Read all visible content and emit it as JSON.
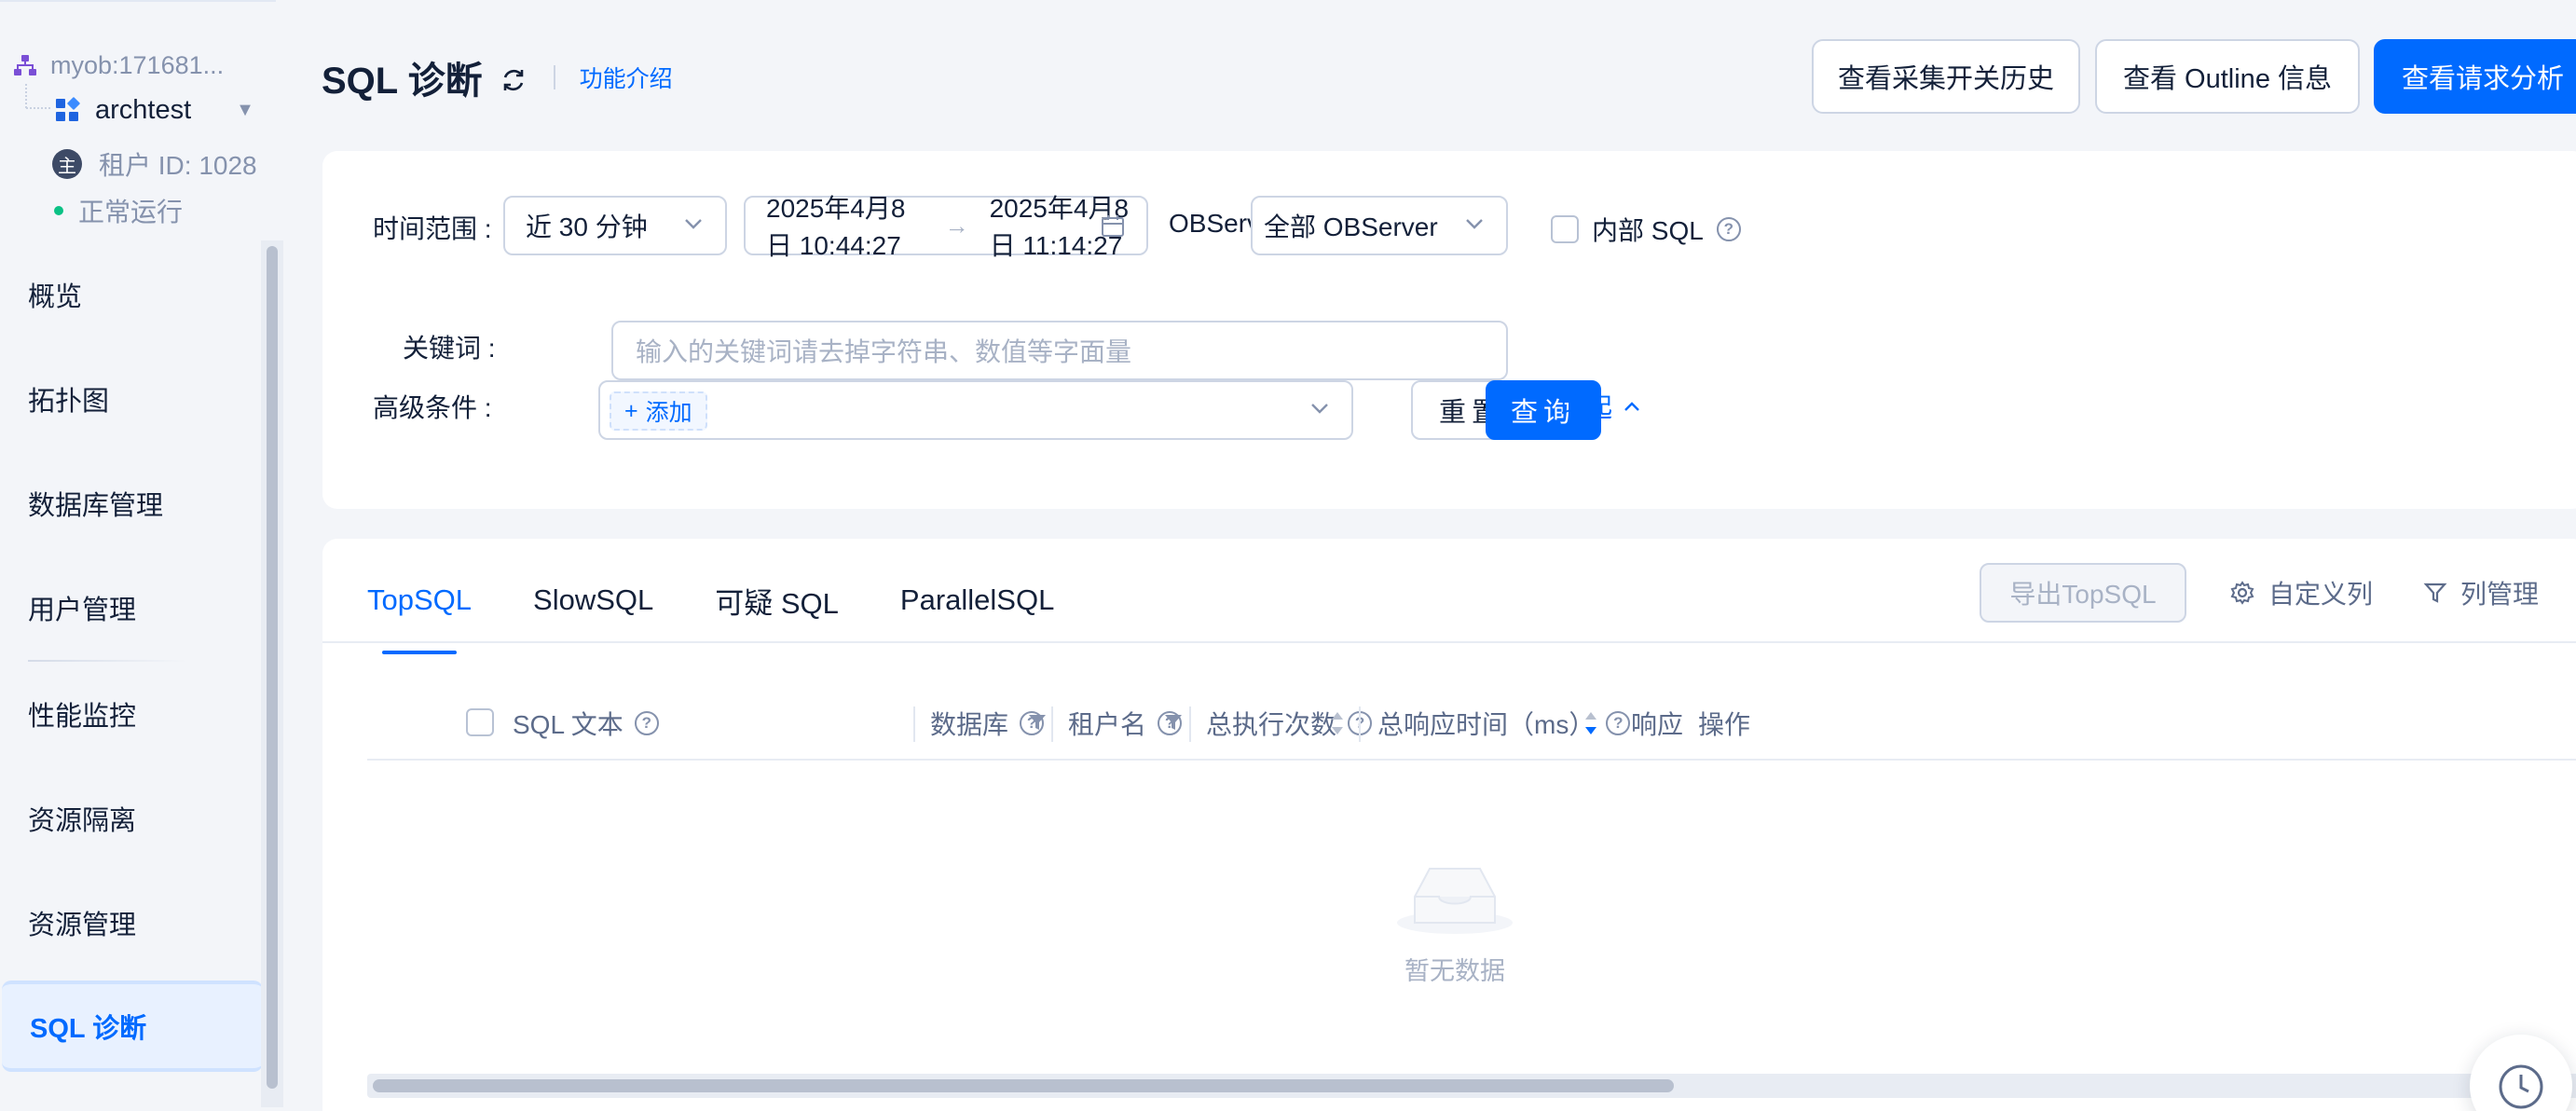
{
  "sidebar": {
    "cluster": "myob:171681...",
    "tenant": "archtest",
    "tenant_id_badge": "主",
    "tenant_id": "租户 ID: 1028",
    "status": "正常运行",
    "items": [
      {
        "label": "概览"
      },
      {
        "label": "拓扑图"
      },
      {
        "label": "数据库管理"
      },
      {
        "label": "用户管理"
      },
      {
        "label": "性能监控"
      },
      {
        "label": "资源隔离"
      },
      {
        "label": "资源管理"
      },
      {
        "label": "SQL 诊断"
      }
    ]
  },
  "header": {
    "title": "SQL 诊断",
    "intro_link": "功能介绍",
    "btn_collect_history": "查看采集开关历史",
    "btn_outline": "查看 Outline 信息",
    "btn_request_analysis": "查看请求分析"
  },
  "filters": {
    "time_range_label": "时间范围 :",
    "time_range_value": "近 30 分钟",
    "date_start": "2025年4月8日 10:44:27",
    "date_end": "2025年4月8日 11:14:27",
    "observer_label": "OBServer :",
    "observer_value": "全部 OBServer",
    "internal_sql_label": "内部 SQL",
    "keyword_label": "关键词 :",
    "keyword_placeholder": "输入的关键词请去掉字符串、数值等字面量",
    "advanced_label": "高级条件 :",
    "add_label": "添加",
    "reset_label": "重置",
    "query_label": "查询",
    "collapse_label": "收起"
  },
  "tabs": [
    {
      "label": "TopSQL"
    },
    {
      "label": "SlowSQL"
    },
    {
      "label": "可疑 SQL"
    },
    {
      "label": "ParallelSQL"
    }
  ],
  "toolbar": {
    "export_label": "导出TopSQL",
    "custom_columns": "自定义列",
    "column_manage": "列管理"
  },
  "table": {
    "columns": [
      {
        "label": "SQL 文本"
      },
      {
        "label": "数据库"
      },
      {
        "label": "租户名"
      },
      {
        "label": "总执行次数"
      },
      {
        "label": "总响应时间（ms）"
      },
      {
        "label": "响应时间"
      },
      {
        "label": "操作"
      }
    ],
    "empty_text": "暂无数据"
  },
  "colors": {
    "primary": "#006aff",
    "status_ok": "#0ac185",
    "text": "#132039",
    "muted": "#8592ad"
  }
}
